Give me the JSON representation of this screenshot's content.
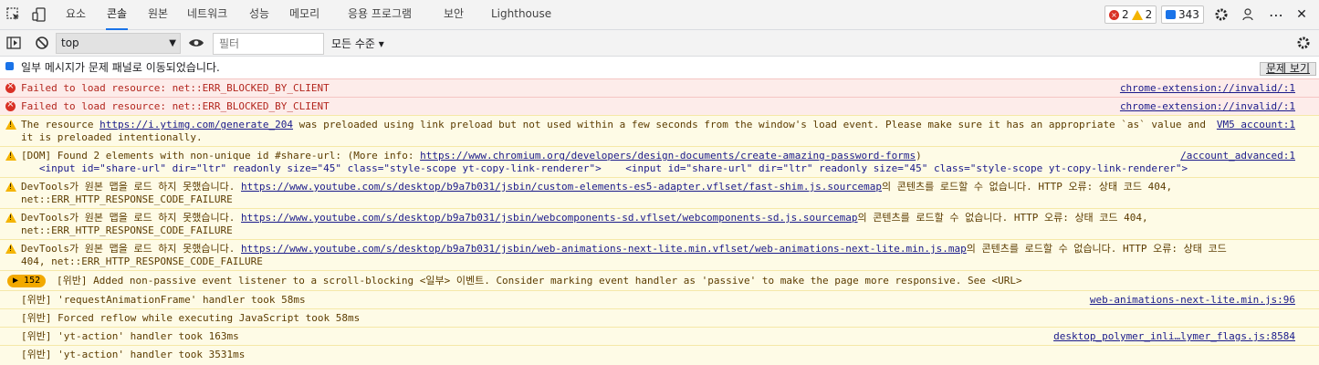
{
  "tabs": [
    "요소",
    "콘솔",
    "원본",
    "네트워크",
    "성능",
    "메모리",
    "응용 프로그램",
    "보안",
    "Lighthouse"
  ],
  "active_tab": "콘솔",
  "badges": {
    "errors": "2",
    "warnings": "2",
    "messages": "343"
  },
  "toolbar": {
    "context": "top",
    "filter_placeholder": "필터",
    "levels": "모든 수준 ▾"
  },
  "info_row": {
    "text": "일부 메시지가 문제 패널로 이동되었습니다.",
    "button": "문제 보기"
  },
  "rows": [
    {
      "level": "error",
      "text": "Failed to load resource: net::ERR_BLOCKED_BY_CLIENT",
      "source": "chrome-extension://invalid/:1"
    },
    {
      "level": "error",
      "text": "Failed to load resource: net::ERR_BLOCKED_BY_CLIENT",
      "source": "chrome-extension://invalid/:1"
    },
    {
      "level": "warning",
      "pre": "The resource ",
      "link": "https://i.ytimg.com/generate_204",
      "post": " was preloaded using link preload but not used within a few seconds from the window's load event. Please make sure it has an appropriate `as` value and",
      "line2": "it is preloaded intentionally.",
      "source": "VM5 account:1"
    },
    {
      "level": "warning",
      "pre": "[DOM] Found 2 elements with non-unique id #share-url: (More info: ",
      "link": "https://www.chromium.org/developers/design-documents/create-amazing-password-forms",
      "post": ")",
      "line2": "   <input id=\"share-url\" dir=\"ltr\" readonly size=\"45\" class=\"style-scope yt-copy-link-renderer\">    <input id=\"share-url\" dir=\"ltr\" readonly size=\"45\" class=\"style-scope yt-copy-link-renderer\">",
      "source": "/account_advanced:1"
    },
    {
      "level": "warning",
      "pre": "DevTools가 원본 맵을 로드 하지 못했습니다. ",
      "link": "https://www.youtube.com/s/desktop/b9a7b031/jsbin/custom-elements-es5-adapter.vflset/fast-shim.js.sourcemap",
      "post": "의 콘텐츠를 로드할 수 없습니다. HTTP 오류: 상태 코드 404,",
      "line2": "net::ERR_HTTP_RESPONSE_CODE_FAILURE",
      "source": ""
    },
    {
      "level": "warning",
      "pre": "DevTools가 원본 맵을 로드 하지 못했습니다. ",
      "link": "https://www.youtube.com/s/desktop/b9a7b031/jsbin/webcomponents-sd.vflset/webcomponents-sd.js.sourcemap",
      "post": "의 콘텐츠를 로드할 수 없습니다. HTTP 오류: 상태 코드 404,",
      "line2": "net::ERR_HTTP_RESPONSE_CODE_FAILURE",
      "source": ""
    },
    {
      "level": "warning",
      "pre": "DevTools가 원본 맵을 로드 하지 못했습니다. ",
      "link": "https://www.youtube.com/s/desktop/b9a7b031/jsbin/web-animations-next-lite.min.vflset/web-animations-next-lite.min.js.map",
      "post": "의 콘텐츠를 로드할 수 없습니다. HTTP 오류: 상태 코드",
      "line2": "404, net::ERR_HTTP_RESPONSE_CODE_FAILURE",
      "source": ""
    }
  ],
  "group": {
    "count": "152",
    "text": "[위반] Added non-passive event listener to a scroll-blocking <일부> 이벤트. Consider marking event handler as 'passive' to make the page more responsive. See <URL>"
  },
  "violations": [
    {
      "text": "[위반] 'requestAnimationFrame' handler took 58ms",
      "source": "web-animations-next-lite.min.js:96"
    },
    {
      "text": "[위반] Forced reflow while executing JavaScript took 58ms",
      "source": ""
    },
    {
      "text": "[위반] 'yt-action' handler took 163ms",
      "source": "desktop_polymer_inli…lymer_flags.js:8584"
    },
    {
      "text": "[위반] 'yt-action' handler took 3531ms",
      "source": ""
    }
  ]
}
